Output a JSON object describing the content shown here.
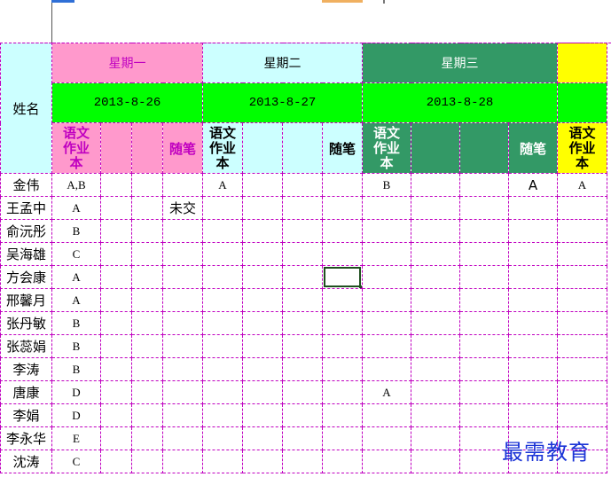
{
  "header": {
    "name_label": "姓名",
    "days": [
      {
        "day": "星期一",
        "date": "2013-8-26",
        "color": "#ff99cc",
        "day_text_color": "#c000c0"
      },
      {
        "day": "星期二",
        "date": "2013-8-27",
        "color": "#ccffff",
        "day_text_color": "#000000"
      },
      {
        "day": "星期三",
        "date": "2013-8-28",
        "color": "#339966",
        "day_text_color": "#ffffff"
      },
      {
        "day": "",
        "date": "",
        "color": "#ffff00",
        "day_text_color": "#000000"
      }
    ],
    "date_row_color": "#00ff00",
    "homework_label": "语文作业本",
    "essay_label": "随笔"
  },
  "students": [
    {
      "name": "金伟",
      "mon": [
        "A,B",
        "",
        "",
        ""
      ],
      "tue": [
        "A",
        "",
        "",
        ""
      ],
      "wed": [
        "B",
        "",
        "",
        "A"
      ],
      "thu": [
        "A"
      ]
    },
    {
      "name": "王孟中",
      "mon": [
        "A",
        "",
        "",
        "未交"
      ],
      "tue": [
        "",
        "",
        "",
        ""
      ],
      "wed": [
        "",
        "",
        "",
        ""
      ],
      "thu": [
        ""
      ]
    },
    {
      "name": "俞沅彤",
      "mon": [
        "B",
        "",
        "",
        ""
      ],
      "tue": [
        "",
        "",
        "",
        ""
      ],
      "wed": [
        "",
        "",
        "",
        ""
      ],
      "thu": [
        ""
      ]
    },
    {
      "name": "吴海雄",
      "mon": [
        "C",
        "",
        "",
        ""
      ],
      "tue": [
        "",
        "",
        "",
        ""
      ],
      "wed": [
        "",
        "",
        "",
        ""
      ],
      "thu": [
        ""
      ]
    },
    {
      "name": "方会康",
      "mon": [
        "A",
        "",
        "",
        ""
      ],
      "tue": [
        "",
        "",
        "",
        ""
      ],
      "wed": [
        "",
        "",
        "",
        ""
      ],
      "thu": [
        ""
      ]
    },
    {
      "name": "邢馨月",
      "mon": [
        "A",
        "",
        "",
        ""
      ],
      "tue": [
        "",
        "",
        "",
        ""
      ],
      "wed": [
        "",
        "",
        "",
        ""
      ],
      "thu": [
        ""
      ]
    },
    {
      "name": "张丹敏",
      "mon": [
        "B",
        "",
        "",
        ""
      ],
      "tue": [
        "",
        "",
        "",
        ""
      ],
      "wed": [
        "",
        "",
        "",
        ""
      ],
      "thu": [
        ""
      ]
    },
    {
      "name": "张蕊娟",
      "mon": [
        "B",
        "",
        "",
        ""
      ],
      "tue": [
        "",
        "",
        "",
        ""
      ],
      "wed": [
        "",
        "",
        "",
        ""
      ],
      "thu": [
        ""
      ]
    },
    {
      "name": "李涛",
      "mon": [
        "B",
        "",
        "",
        ""
      ],
      "tue": [
        "",
        "",
        "",
        ""
      ],
      "wed": [
        "",
        "",
        "",
        ""
      ],
      "thu": [
        ""
      ]
    },
    {
      "name": "唐康",
      "mon": [
        "D",
        "",
        "",
        ""
      ],
      "tue": [
        "",
        "",
        "",
        ""
      ],
      "wed": [
        "A",
        "",
        "",
        ""
      ],
      "thu": [
        ""
      ]
    },
    {
      "name": "李娟",
      "mon": [
        "D",
        "",
        "",
        ""
      ],
      "tue": [
        "",
        "",
        "",
        ""
      ],
      "wed": [
        "",
        "",
        "",
        ""
      ],
      "thu": [
        ""
      ]
    },
    {
      "name": "李永华",
      "mon": [
        "E",
        "",
        "",
        ""
      ],
      "tue": [
        "",
        "",
        "",
        ""
      ],
      "wed": [
        "",
        "",
        "",
        ""
      ],
      "thu": [
        ""
      ]
    },
    {
      "name": "沈涛",
      "mon": [
        "C",
        "",
        "",
        ""
      ],
      "tue": [
        "",
        "",
        "",
        ""
      ],
      "wed": [
        "",
        "",
        "",
        ""
      ],
      "thu": [
        ""
      ]
    }
  ],
  "watermark": "最需教育"
}
